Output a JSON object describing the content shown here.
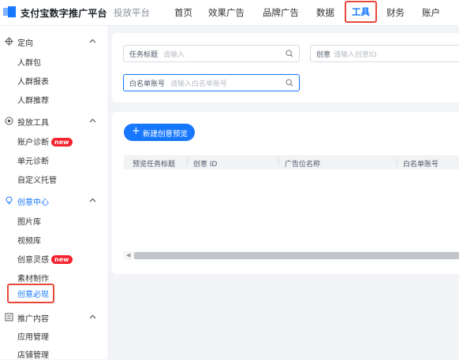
{
  "header": {
    "brand": "支付宝数字推广平台",
    "sub_brand": "投放平台",
    "nav": [
      "首页",
      "效果广告",
      "品牌广告",
      "数据",
      "工具",
      "财务",
      "账户"
    ],
    "active_nav": "工具"
  },
  "sidebar": {
    "groups": [
      {
        "label": "定向",
        "icon": "target-icon",
        "items": [
          "人群包",
          "人群报表",
          "人群推荐"
        ]
      },
      {
        "label": "投放工具",
        "icon": "tools-icon",
        "items": [
          "账户诊断",
          "单元诊断",
          "自定义托管"
        ]
      },
      {
        "label": "创意中心",
        "icon": "lightbulb-icon",
        "items": [
          "图片库",
          "视频库",
          "创意灵感",
          "素材制作",
          "创意必现"
        ]
      },
      {
        "label": "推广内容",
        "icon": "content-icon",
        "items": [
          "应用管理",
          "店铺管理"
        ]
      }
    ],
    "badge_new": "new",
    "selected_item": "创意必现"
  },
  "filters": {
    "task_title_label": "任务标题",
    "task_title_placeholder": "请输入",
    "creative_label": "创意",
    "creative_placeholder": "请输入创意ID",
    "whitelist_label": "白名单账号",
    "whitelist_placeholder": "请输入白名单账号"
  },
  "table": {
    "new_button": "新建创意预览",
    "columns": [
      "预览任务标题",
      "创意 ID",
      "广告位名称",
      "白名单账号"
    ]
  },
  "colors": {
    "primary": "#1677ff",
    "highlight_border": "#e8483a",
    "badge": "#f5222d"
  }
}
